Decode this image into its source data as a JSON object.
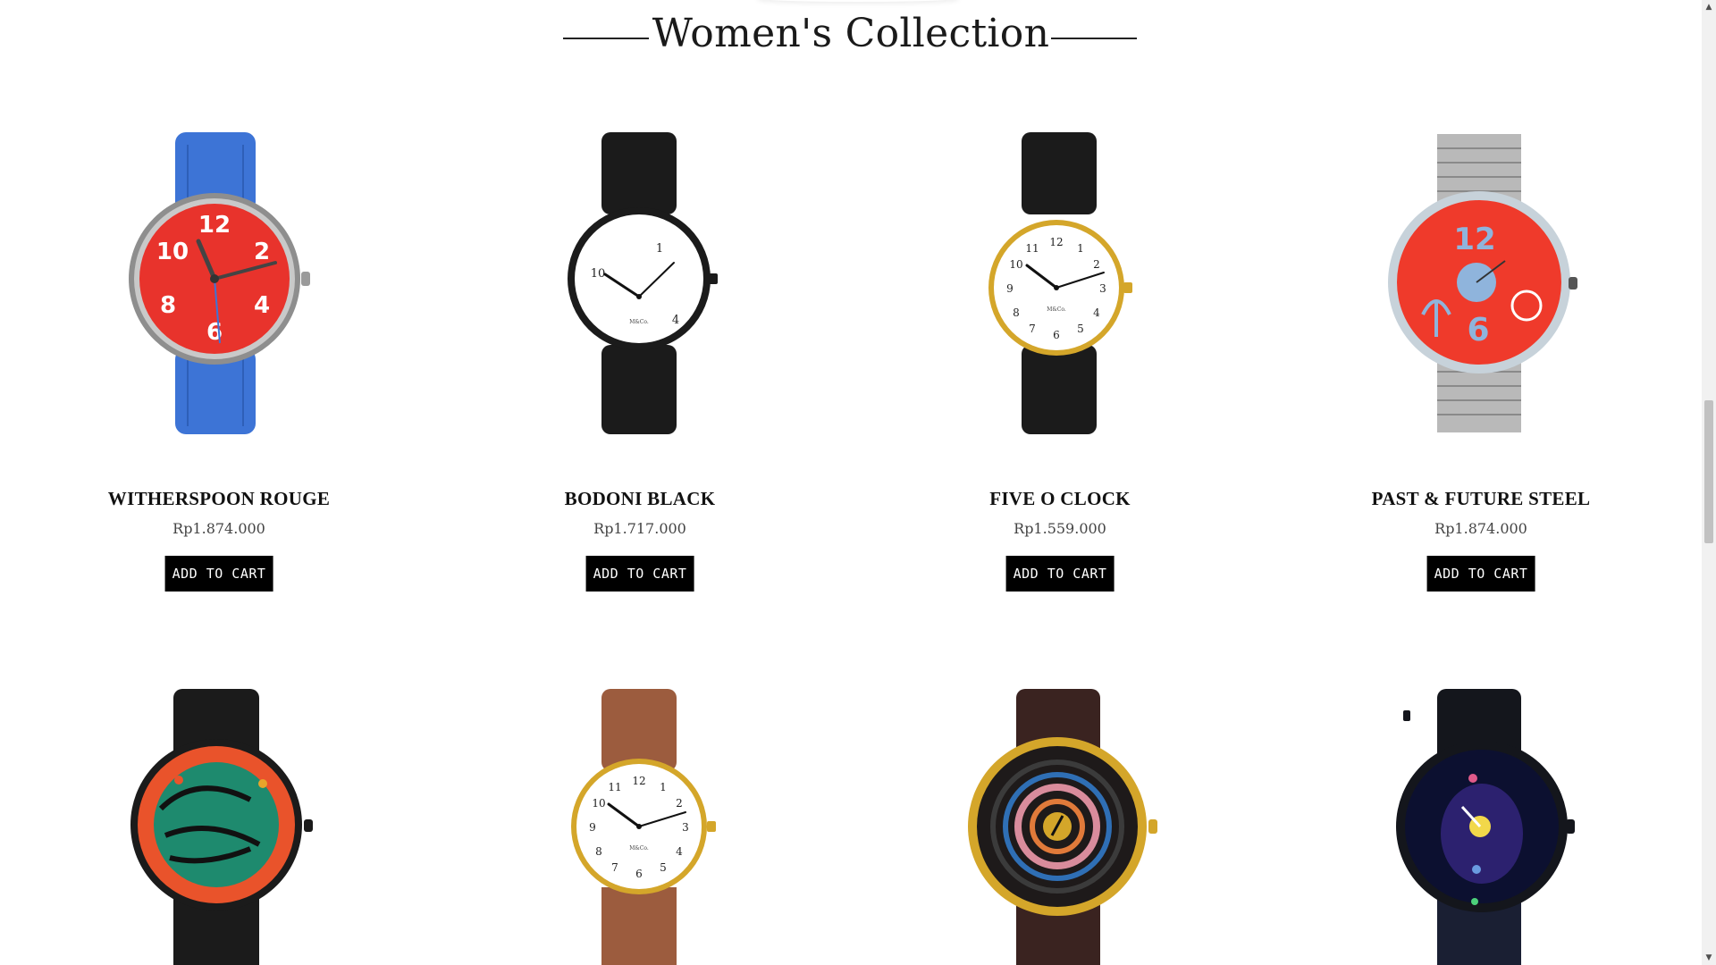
{
  "section": {
    "title": "Women's Collection"
  },
  "products": [
    {
      "name": "WITHERSPOON ROUGE",
      "price": "Rp1.874.000",
      "cta": "ADD TO CART",
      "icon": "witherspoon-rouge-watch-icon"
    },
    {
      "name": "BODONI BLACK",
      "price": "Rp1.717.000",
      "cta": "ADD TO CART",
      "icon": "bodoni-black-watch-icon"
    },
    {
      "name": "FIVE O CLOCK",
      "price": "Rp1.559.000",
      "cta": "ADD TO CART",
      "icon": "five-o-clock-watch-icon"
    },
    {
      "name": "PAST & FUTURE STEEL",
      "price": "Rp1.874.000",
      "cta": "ADD TO CART",
      "icon": "past-future-steel-watch-icon"
    },
    {
      "icon": "tribal-orange-watch-icon"
    },
    {
      "icon": "brown-strap-gold-watch-icon"
    },
    {
      "icon": "concentric-gold-watch-icon"
    },
    {
      "icon": "cosmic-navy-watch-icon"
    }
  ],
  "watch_faces": {
    "rouge": {
      "numerals": [
        "12",
        "2",
        "4",
        "6",
        "8",
        "10"
      ]
    },
    "bodoni": {
      "numerals": [
        "1",
        "4",
        "10"
      ],
      "brand": "M&Co."
    },
    "fiveoclock": {
      "numerals": [
        "12",
        "1",
        "2",
        "3",
        "4",
        "5",
        "6",
        "7",
        "8",
        "9",
        "10",
        "11"
      ],
      "brand": "M&Co."
    },
    "past_future": {
      "numerals": [
        "12",
        "6"
      ]
    }
  },
  "colors": {
    "accent": "#000000",
    "rouge_face": "#e8332c",
    "rouge_strap": "#3d74d6",
    "gold": "#d4a62a",
    "steel_face": "#ef3a2b",
    "steel_numeral": "#8fb4dc"
  },
  "scrollbar": {
    "up_icon": "scroll-up-icon",
    "down_icon": "scroll-down-icon"
  }
}
